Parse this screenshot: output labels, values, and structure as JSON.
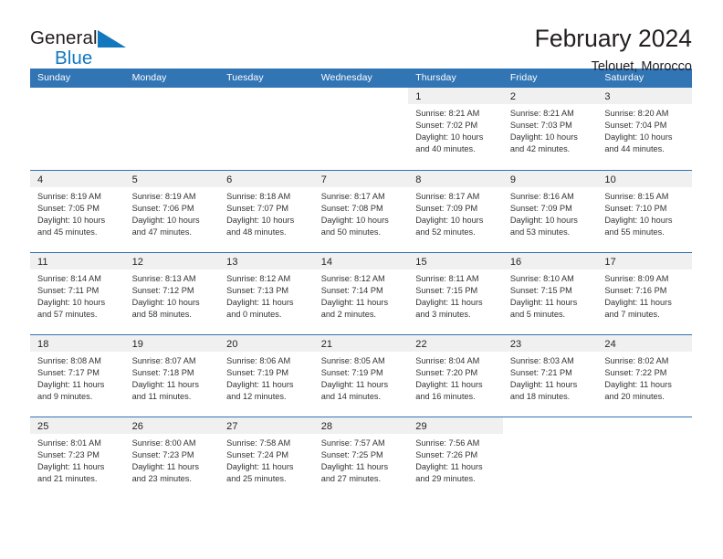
{
  "brand": {
    "name_part1": "General",
    "name_part2": "Blue",
    "logo_icon": "blue-triangle-logo-icon",
    "accent_color": "#1278be"
  },
  "header": {
    "title": "February 2024",
    "subtitle": "Telouet, Morocco"
  },
  "theme": {
    "header_blue": "#3275b5",
    "band_gray": "#f0f0f0",
    "text": "#231f20"
  },
  "weekdays": [
    "Sunday",
    "Monday",
    "Tuesday",
    "Wednesday",
    "Thursday",
    "Friday",
    "Saturday"
  ],
  "weeks": [
    [
      {
        "day": "",
        "blank": true,
        "sunrise": "",
        "sunset": "",
        "daylight_line1": "",
        "daylight_line2": ""
      },
      {
        "day": "",
        "blank": true,
        "sunrise": "",
        "sunset": "",
        "daylight_line1": "",
        "daylight_line2": ""
      },
      {
        "day": "",
        "blank": true,
        "sunrise": "",
        "sunset": "",
        "daylight_line1": "",
        "daylight_line2": ""
      },
      {
        "day": "",
        "blank": true,
        "sunrise": "",
        "sunset": "",
        "daylight_line1": "",
        "daylight_line2": ""
      },
      {
        "day": "1",
        "sunrise": "Sunrise: 8:21 AM",
        "sunset": "Sunset: 7:02 PM",
        "daylight_line1": "Daylight: 10 hours",
        "daylight_line2": "and 40 minutes."
      },
      {
        "day": "2",
        "sunrise": "Sunrise: 8:21 AM",
        "sunset": "Sunset: 7:03 PM",
        "daylight_line1": "Daylight: 10 hours",
        "daylight_line2": "and 42 minutes."
      },
      {
        "day": "3",
        "sunrise": "Sunrise: 8:20 AM",
        "sunset": "Sunset: 7:04 PM",
        "daylight_line1": "Daylight: 10 hours",
        "daylight_line2": "and 44 minutes."
      }
    ],
    [
      {
        "day": "4",
        "sunrise": "Sunrise: 8:19 AM",
        "sunset": "Sunset: 7:05 PM",
        "daylight_line1": "Daylight: 10 hours",
        "daylight_line2": "and 45 minutes."
      },
      {
        "day": "5",
        "sunrise": "Sunrise: 8:19 AM",
        "sunset": "Sunset: 7:06 PM",
        "daylight_line1": "Daylight: 10 hours",
        "daylight_line2": "and 47 minutes."
      },
      {
        "day": "6",
        "sunrise": "Sunrise: 8:18 AM",
        "sunset": "Sunset: 7:07 PM",
        "daylight_line1": "Daylight: 10 hours",
        "daylight_line2": "and 48 minutes."
      },
      {
        "day": "7",
        "sunrise": "Sunrise: 8:17 AM",
        "sunset": "Sunset: 7:08 PM",
        "daylight_line1": "Daylight: 10 hours",
        "daylight_line2": "and 50 minutes."
      },
      {
        "day": "8",
        "sunrise": "Sunrise: 8:17 AM",
        "sunset": "Sunset: 7:09 PM",
        "daylight_line1": "Daylight: 10 hours",
        "daylight_line2": "and 52 minutes."
      },
      {
        "day": "9",
        "sunrise": "Sunrise: 8:16 AM",
        "sunset": "Sunset: 7:09 PM",
        "daylight_line1": "Daylight: 10 hours",
        "daylight_line2": "and 53 minutes."
      },
      {
        "day": "10",
        "sunrise": "Sunrise: 8:15 AM",
        "sunset": "Sunset: 7:10 PM",
        "daylight_line1": "Daylight: 10 hours",
        "daylight_line2": "and 55 minutes."
      }
    ],
    [
      {
        "day": "11",
        "sunrise": "Sunrise: 8:14 AM",
        "sunset": "Sunset: 7:11 PM",
        "daylight_line1": "Daylight: 10 hours",
        "daylight_line2": "and 57 minutes."
      },
      {
        "day": "12",
        "sunrise": "Sunrise: 8:13 AM",
        "sunset": "Sunset: 7:12 PM",
        "daylight_line1": "Daylight: 10 hours",
        "daylight_line2": "and 58 minutes."
      },
      {
        "day": "13",
        "sunrise": "Sunrise: 8:12 AM",
        "sunset": "Sunset: 7:13 PM",
        "daylight_line1": "Daylight: 11 hours",
        "daylight_line2": "and 0 minutes."
      },
      {
        "day": "14",
        "sunrise": "Sunrise: 8:12 AM",
        "sunset": "Sunset: 7:14 PM",
        "daylight_line1": "Daylight: 11 hours",
        "daylight_line2": "and 2 minutes."
      },
      {
        "day": "15",
        "sunrise": "Sunrise: 8:11 AM",
        "sunset": "Sunset: 7:15 PM",
        "daylight_line1": "Daylight: 11 hours",
        "daylight_line2": "and 3 minutes."
      },
      {
        "day": "16",
        "sunrise": "Sunrise: 8:10 AM",
        "sunset": "Sunset: 7:15 PM",
        "daylight_line1": "Daylight: 11 hours",
        "daylight_line2": "and 5 minutes."
      },
      {
        "day": "17",
        "sunrise": "Sunrise: 8:09 AM",
        "sunset": "Sunset: 7:16 PM",
        "daylight_line1": "Daylight: 11 hours",
        "daylight_line2": "and 7 minutes."
      }
    ],
    [
      {
        "day": "18",
        "sunrise": "Sunrise: 8:08 AM",
        "sunset": "Sunset: 7:17 PM",
        "daylight_line1": "Daylight: 11 hours",
        "daylight_line2": "and 9 minutes."
      },
      {
        "day": "19",
        "sunrise": "Sunrise: 8:07 AM",
        "sunset": "Sunset: 7:18 PM",
        "daylight_line1": "Daylight: 11 hours",
        "daylight_line2": "and 11 minutes."
      },
      {
        "day": "20",
        "sunrise": "Sunrise: 8:06 AM",
        "sunset": "Sunset: 7:19 PM",
        "daylight_line1": "Daylight: 11 hours",
        "daylight_line2": "and 12 minutes."
      },
      {
        "day": "21",
        "sunrise": "Sunrise: 8:05 AM",
        "sunset": "Sunset: 7:19 PM",
        "daylight_line1": "Daylight: 11 hours",
        "daylight_line2": "and 14 minutes."
      },
      {
        "day": "22",
        "sunrise": "Sunrise: 8:04 AM",
        "sunset": "Sunset: 7:20 PM",
        "daylight_line1": "Daylight: 11 hours",
        "daylight_line2": "and 16 minutes."
      },
      {
        "day": "23",
        "sunrise": "Sunrise: 8:03 AM",
        "sunset": "Sunset: 7:21 PM",
        "daylight_line1": "Daylight: 11 hours",
        "daylight_line2": "and 18 minutes."
      },
      {
        "day": "24",
        "sunrise": "Sunrise: 8:02 AM",
        "sunset": "Sunset: 7:22 PM",
        "daylight_line1": "Daylight: 11 hours",
        "daylight_line2": "and 20 minutes."
      }
    ],
    [
      {
        "day": "25",
        "sunrise": "Sunrise: 8:01 AM",
        "sunset": "Sunset: 7:23 PM",
        "daylight_line1": "Daylight: 11 hours",
        "daylight_line2": "and 21 minutes."
      },
      {
        "day": "26",
        "sunrise": "Sunrise: 8:00 AM",
        "sunset": "Sunset: 7:23 PM",
        "daylight_line1": "Daylight: 11 hours",
        "daylight_line2": "and 23 minutes."
      },
      {
        "day": "27",
        "sunrise": "Sunrise: 7:58 AM",
        "sunset": "Sunset: 7:24 PM",
        "daylight_line1": "Daylight: 11 hours",
        "daylight_line2": "and 25 minutes."
      },
      {
        "day": "28",
        "sunrise": "Sunrise: 7:57 AM",
        "sunset": "Sunset: 7:25 PM",
        "daylight_line1": "Daylight: 11 hours",
        "daylight_line2": "and 27 minutes."
      },
      {
        "day": "29",
        "sunrise": "Sunrise: 7:56 AM",
        "sunset": "Sunset: 7:26 PM",
        "daylight_line1": "Daylight: 11 hours",
        "daylight_line2": "and 29 minutes."
      },
      {
        "day": "",
        "blank": true,
        "sunrise": "",
        "sunset": "",
        "daylight_line1": "",
        "daylight_line2": ""
      },
      {
        "day": "",
        "blank": true,
        "sunrise": "",
        "sunset": "",
        "daylight_line1": "",
        "daylight_line2": ""
      }
    ]
  ]
}
